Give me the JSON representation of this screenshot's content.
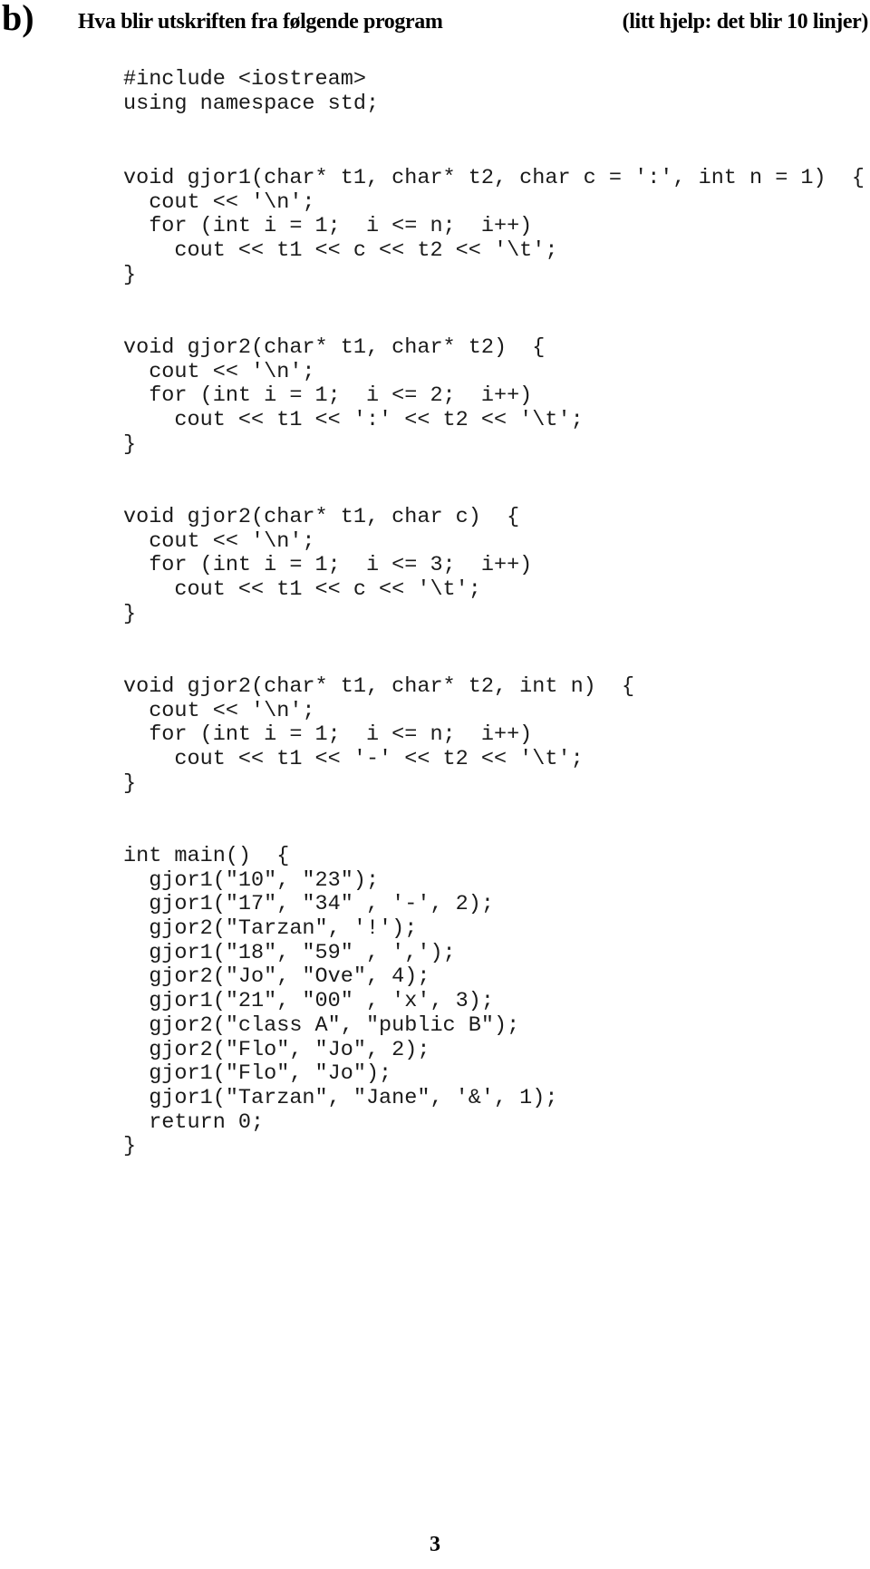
{
  "header": {
    "part_label": "b)",
    "question": "Hva blir utskriften fra følgende program",
    "hint": "(litt hjelp: det blir 10 linjer)"
  },
  "code": {
    "includes": [
      "#include <iostream>",
      "using namespace std;"
    ],
    "gjor1": [
      "void gjor1(char* t1, char* t2, char c = ':', int n = 1)  {",
      "  cout << '\\n';",
      "  for (int i = 1;  i <= n;  i++)",
      "    cout << t1 << c << t2 << '\\t';",
      "}"
    ],
    "gjor2a": [
      "void gjor2(char* t1, char* t2)  {",
      "  cout << '\\n';",
      "  for (int i = 1;  i <= 2;  i++)",
      "    cout << t1 << ':' << t2 << '\\t';",
      "}"
    ],
    "gjor2b": [
      "void gjor2(char* t1, char c)  {",
      "  cout << '\\n';",
      "  for (int i = 1;  i <= 3;  i++)",
      "    cout << t1 << c << '\\t';",
      "}"
    ],
    "gjor2c": [
      "void gjor2(char* t1, char* t2, int n)  {",
      "  cout << '\\n';",
      "  for (int i = 1;  i <= n;  i++)",
      "    cout << t1 << '-' << t2 << '\\t';",
      "}"
    ],
    "main": [
      "int main()  {",
      "  gjor1(\"10\", \"23\");",
      "  gjor1(\"17\", \"34\" , '-', 2);",
      "  gjor2(\"Tarzan\", '!');",
      "  gjor1(\"18\", \"59\" , ',');",
      "  gjor2(\"Jo\", \"Ove\", 4);",
      "  gjor1(\"21\", \"00\" , 'x', 3);",
      "  gjor2(\"class A\", \"public B\");",
      "  gjor2(\"Flo\", \"Jo\", 2);",
      "  gjor1(\"Flo\", \"Jo\");",
      "  gjor1(\"Tarzan\", \"Jane\", '&', 1);",
      "  return 0;",
      "}"
    ]
  },
  "footer": {
    "page_number": "3"
  }
}
